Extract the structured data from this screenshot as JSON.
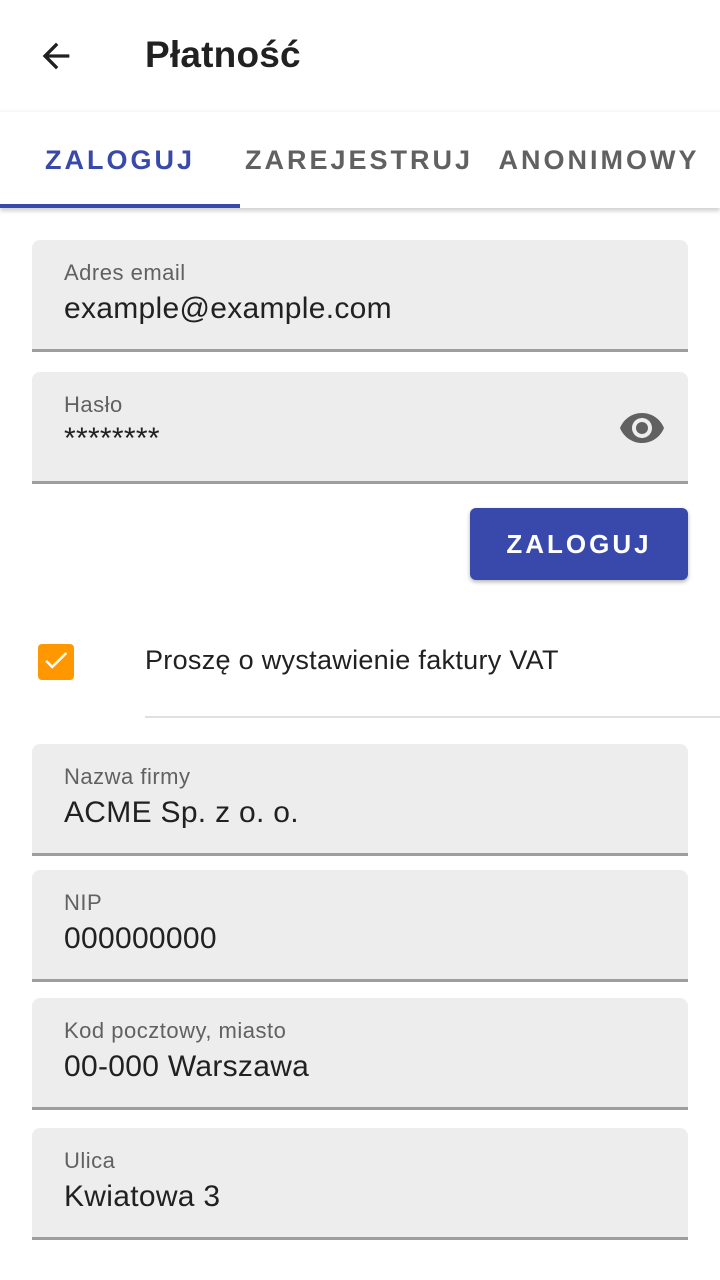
{
  "appbar": {
    "title": "Płatność",
    "back_icon": "arrow-left-icon"
  },
  "tabs": [
    {
      "label": "ZALOGUJ",
      "active": true
    },
    {
      "label": "ZAREJESTRUJ",
      "active": false
    },
    {
      "label": "ANONIMOWY",
      "active": false
    }
  ],
  "login": {
    "email": {
      "label": "Adres email",
      "value": "example@example.com"
    },
    "password": {
      "label": "Hasło",
      "value": "********",
      "visibility_icon": "eye-icon"
    },
    "submit_label": "ZALOGUJ"
  },
  "invoice": {
    "checkbox_checked": true,
    "checkbox_label": "Proszę o wystawienie faktury VAT",
    "company": {
      "label": "Nazwa firmy",
      "value": "ACME Sp. z o. o."
    },
    "nip": {
      "label": "NIP",
      "value": "000000000"
    },
    "postal_city": {
      "label": "Kod pocztowy, miasto",
      "value": "00-000 Warszawa"
    },
    "street": {
      "label": "Ulica",
      "value": "Kwiatowa 3"
    }
  },
  "colors": {
    "primary": "#3949ab",
    "accent": "#ff9800",
    "field_bg": "#ededed"
  }
}
